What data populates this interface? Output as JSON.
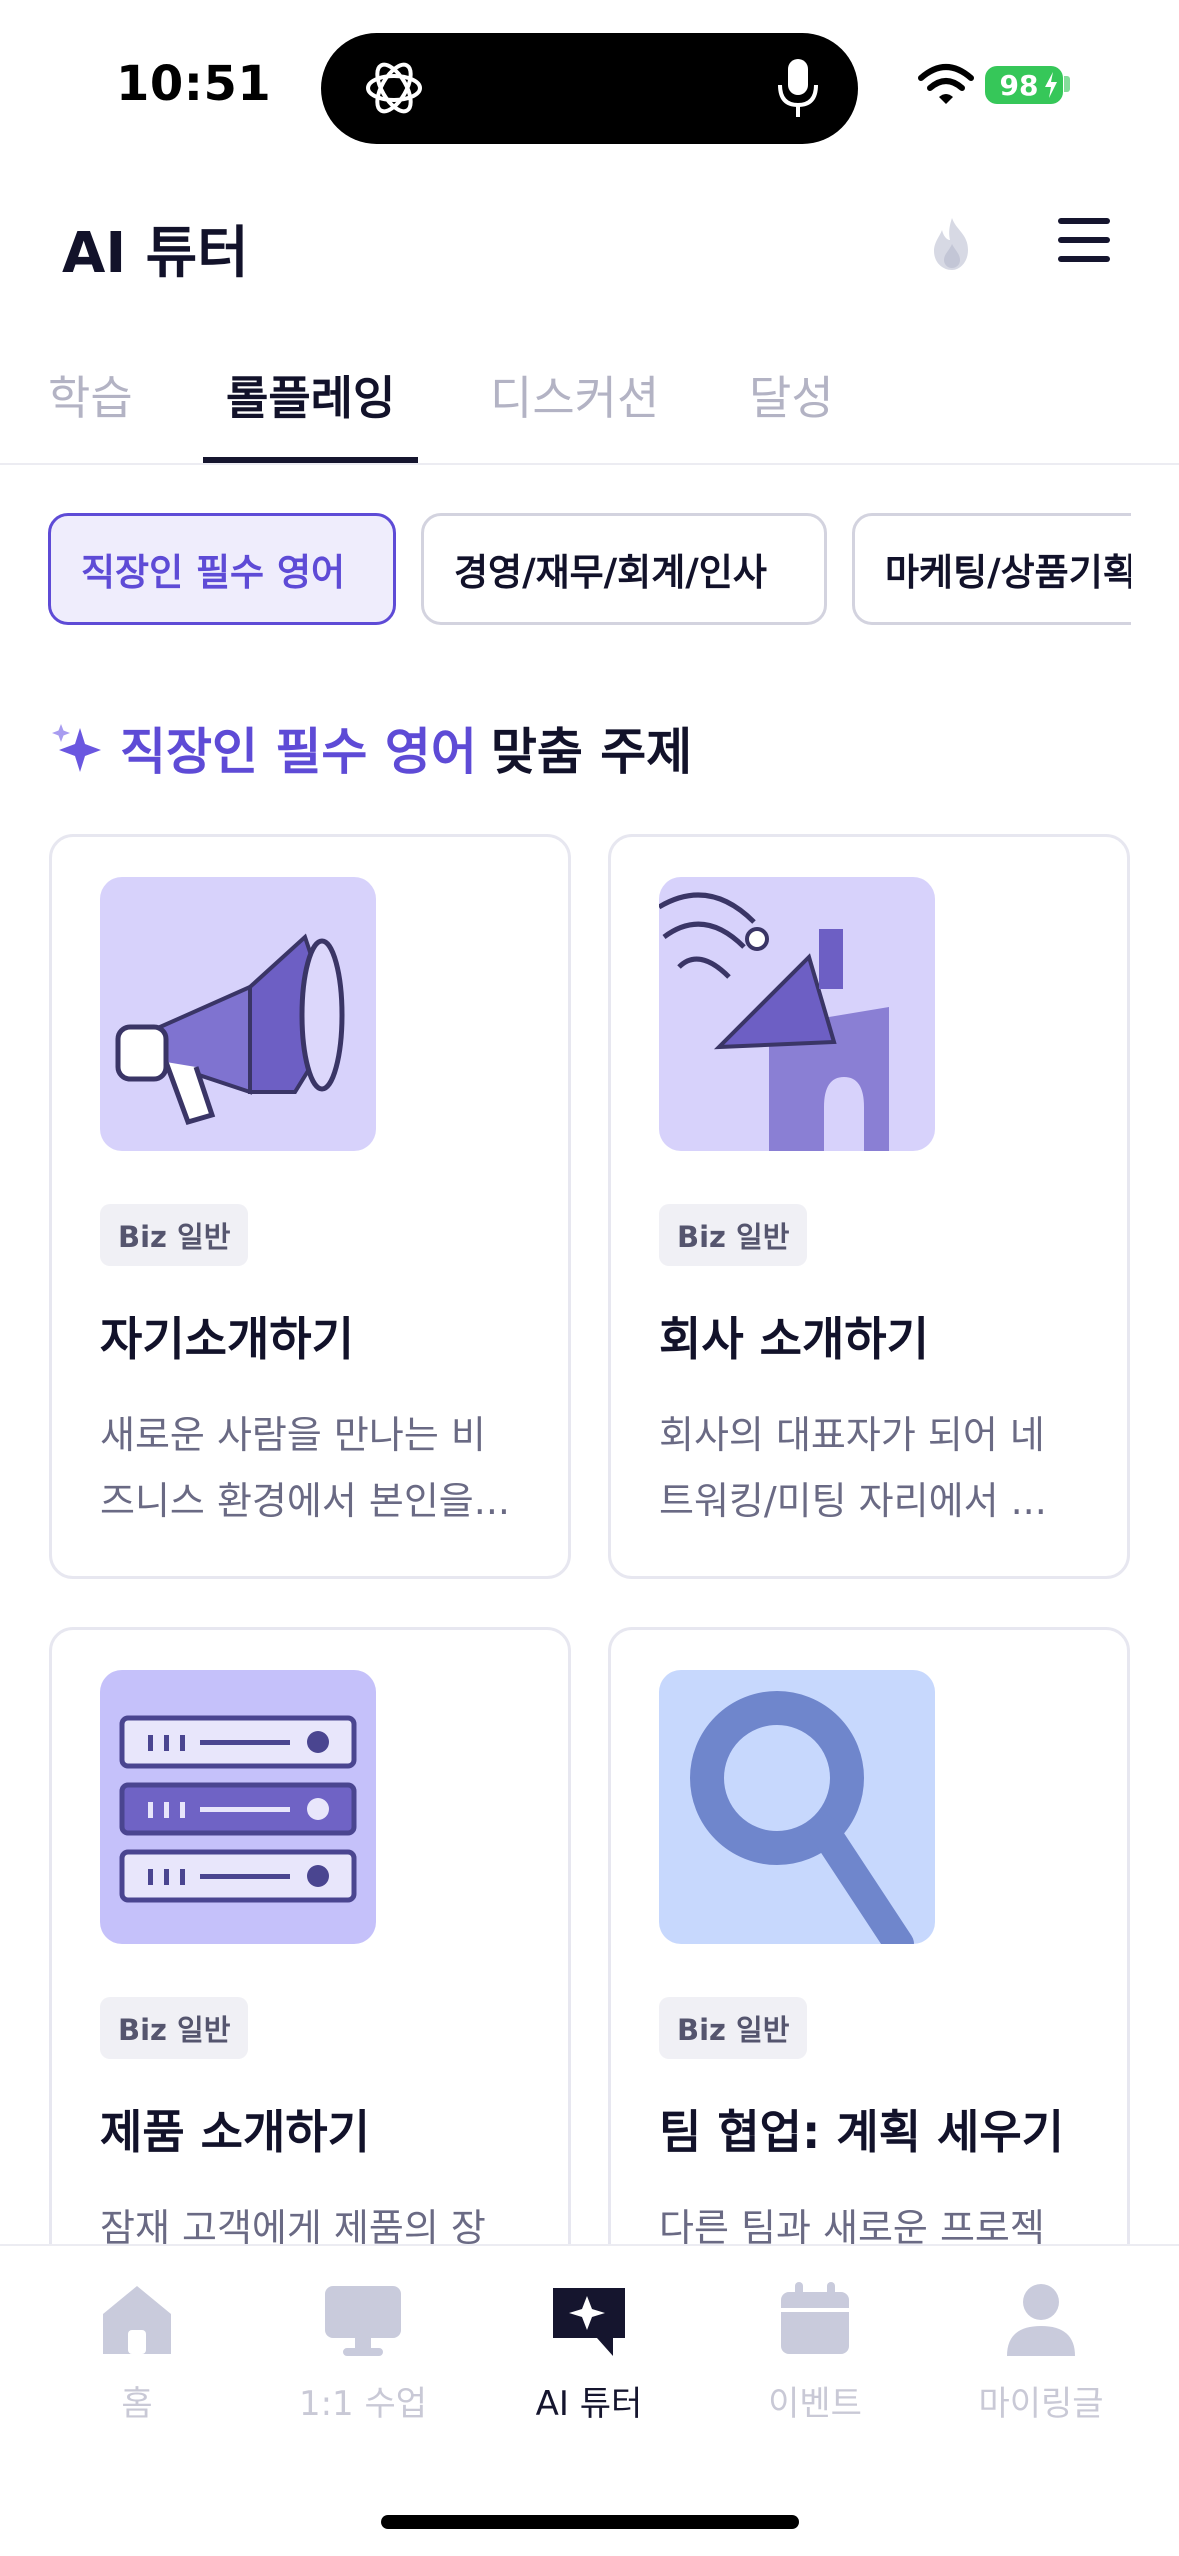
{
  "status_bar": {
    "time": "10:51",
    "battery": "98"
  },
  "header": {
    "title": "AI 튜터"
  },
  "tabs": [
    {
      "label": "학습",
      "active": false
    },
    {
      "label": "롤플레잉",
      "active": true
    },
    {
      "label": "디스커션",
      "active": false
    },
    {
      "label": "달성",
      "active": false
    }
  ],
  "chips": [
    {
      "label": "직장인 필수 영어",
      "active": true
    },
    {
      "label": "경영/재무/회계/인사",
      "active": false
    },
    {
      "label": "마케팅/상품기획",
      "active": false
    }
  ],
  "section": {
    "heading_accent": "직장인 필수 영어",
    "heading_rest": "맞춤 주제"
  },
  "cards": [
    {
      "badge": "Biz 일반",
      "title": "자기소개하기",
      "desc_line1": "새로운 사람을 만나는 비",
      "desc_line2": "즈니스 환경에서 본인을...",
      "icon": "megaphone-illustration",
      "bg": "#d7d2fb"
    },
    {
      "badge": "Biz 일반",
      "title": "회사 소개하기",
      "desc_line1": "회사의 대표자가 되어 네",
      "desc_line2": "트워킹/미팅 자리에서 ...",
      "icon": "building-illustration",
      "bg": "#d7d2fb"
    },
    {
      "badge": "Biz 일반",
      "title": "제품 소개하기",
      "desc_line1": "잠재 고객에게 제품의 장",
      "desc_line2": "",
      "icon": "server-illustration",
      "bg": "#c5c1fa"
    },
    {
      "badge": "Biz 일반",
      "title": "팀 협업: 계획 세우기",
      "desc_line1": "다른 팀과 새로운 프로젝",
      "desc_line2": "",
      "icon": "magnifier-illustration",
      "bg": "#c7d8fd"
    }
  ],
  "bottom_nav": [
    {
      "label": "홈",
      "icon": "home-icon",
      "active": false
    },
    {
      "label": "1:1 수업",
      "icon": "monitor-icon",
      "active": false
    },
    {
      "label": "AI 튜터",
      "icon": "ai-chat-icon",
      "active": true
    },
    {
      "label": "이벤트",
      "icon": "calendar-icon",
      "active": false
    },
    {
      "label": "마이링글",
      "icon": "person-icon",
      "active": false
    }
  ],
  "colors": {
    "accent": "#5e4bd6",
    "text": "#12122a",
    "inactive": "#b3b3c4",
    "battery": "#36c759"
  }
}
